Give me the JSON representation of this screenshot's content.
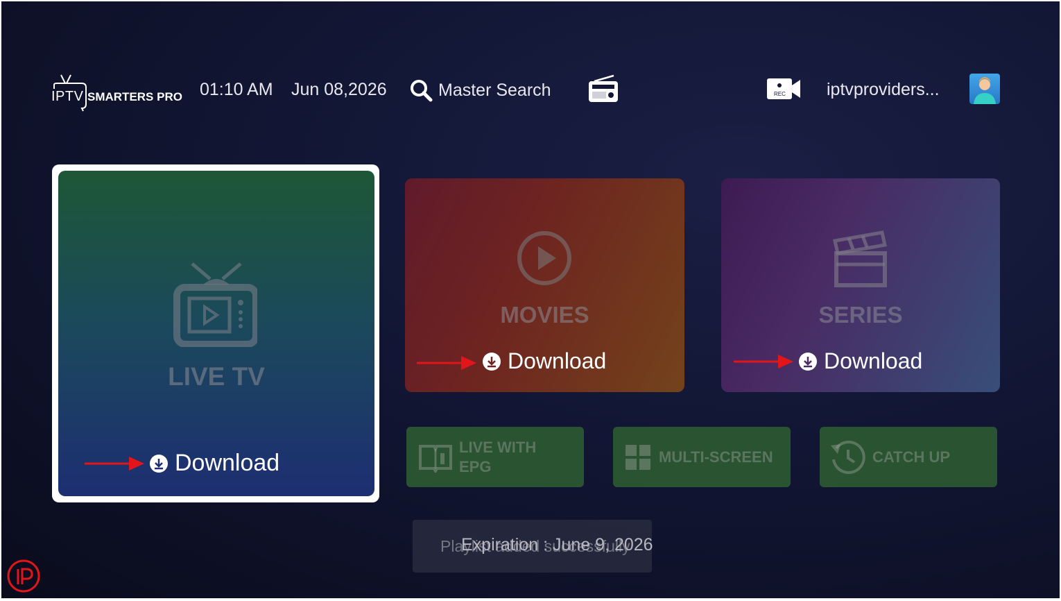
{
  "header": {
    "logo_iptv": "IPTV",
    "logo_smarters": "SMARTERS PRO",
    "time": "01:10 AM",
    "date": "Jun 08,2026",
    "search_label": "Master Search",
    "account_name": "iptvproviders..."
  },
  "tiles": {
    "live_tv": {
      "label": "LIVE TV",
      "download": "Download"
    },
    "movies": {
      "label": "MOVIES",
      "download": "Download"
    },
    "series": {
      "label": "SERIES",
      "download": "Download"
    }
  },
  "small_tiles": {
    "live_epg_line1": "LIVE WITH",
    "live_epg_line2": "EPG",
    "multi_screen": "MULTI-SCREEN",
    "catch_up": "CATCH UP"
  },
  "toast": {
    "behind": "Playlist added successfully",
    "front": "Expiration : June 9, 2026"
  },
  "colors": {
    "arrow": "#e0161b",
    "live_tile_top": "#1d5736",
    "live_tile_bottom": "#1d2e72",
    "small_tile": "#2a5332"
  },
  "icons": [
    "search-icon",
    "radio-icon",
    "record-icon",
    "avatar-icon",
    "tv-icon",
    "play-icon",
    "clapperboard-icon",
    "book-icon",
    "grid-icon",
    "history-icon",
    "download-icon",
    "arrow-icon"
  ]
}
